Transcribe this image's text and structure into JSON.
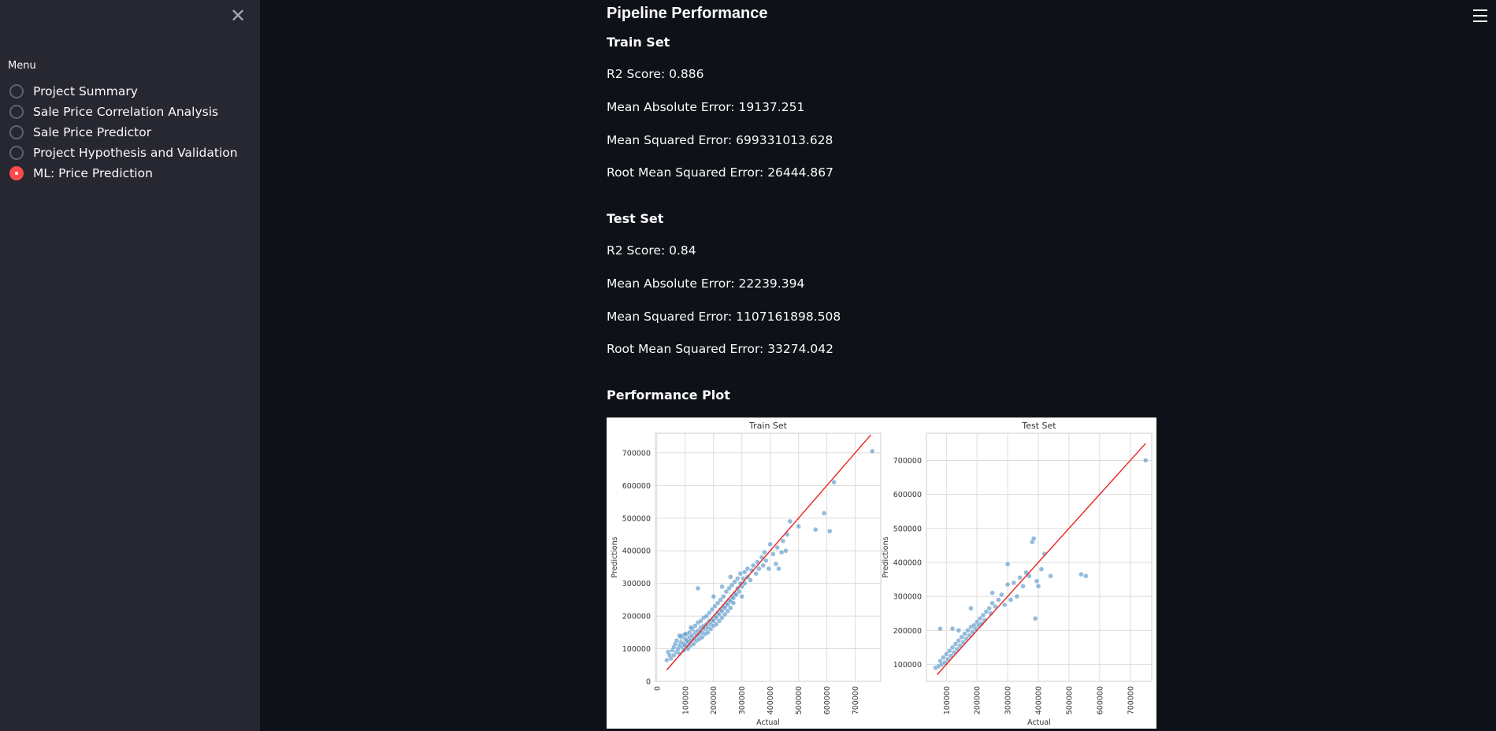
{
  "sidebar": {
    "close_glyph": "✕",
    "menu_label": "Menu",
    "items": [
      {
        "label": "Project Summary",
        "selected": false
      },
      {
        "label": "Sale Price Correlation Analysis",
        "selected": false
      },
      {
        "label": "Sale Price Predictor",
        "selected": false
      },
      {
        "label": "Project Hypothesis and Validation",
        "selected": false
      },
      {
        "label": "ML: Price Prediction",
        "selected": true
      }
    ]
  },
  "main": {
    "title": "Pipeline Performance",
    "train": {
      "heading": "Train Set",
      "r2": "R2 Score: 0.886",
      "mae": "Mean Absolute Error: 19137.251",
      "mse": "Mean Squared Error: 699331013.628",
      "rmse": "Root Mean Squared Error: 26444.867"
    },
    "test": {
      "heading": "Test Set",
      "r2": "R2 Score: 0.84",
      "mae": "Mean Absolute Error: 22239.394",
      "mse": "Mean Squared Error: 1107161898.508",
      "rmse": "Root Mean Squared Error: 33274.042"
    },
    "plot_heading": "Performance Plot"
  },
  "colors": {
    "accent": "#ff4b4b",
    "point": "#4c8fc4",
    "line": "#e8231f"
  },
  "chart_data": [
    {
      "type": "scatter",
      "title": "Train Set",
      "xlabel": "Actual",
      "ylabel": "Predictions",
      "xlim": [
        -5000,
        790000
      ],
      "ylim": [
        0,
        760000
      ],
      "xticks": [
        0,
        100000,
        200000,
        300000,
        400000,
        500000,
        600000,
        700000
      ],
      "yticks": [
        0,
        100000,
        200000,
        300000,
        400000,
        500000,
        600000,
        700000
      ],
      "grid": true,
      "reference_line": {
        "from": [
          35000,
          35000
        ],
        "to": [
          755000,
          755000
        ]
      },
      "points": [
        [
          35000,
          65000
        ],
        [
          40000,
          90000
        ],
        [
          45000,
          80000
        ],
        [
          50000,
          70000
        ],
        [
          55000,
          95000
        ],
        [
          60000,
          105000
        ],
        [
          60000,
          80000
        ],
        [
          65000,
          115000
        ],
        [
          70000,
          90000
        ],
        [
          70000,
          125000
        ],
        [
          75000,
          100000
        ],
        [
          80000,
          110000
        ],
        [
          80000,
          85000
        ],
        [
          85000,
          120000
        ],
        [
          85000,
          135000
        ],
        [
          90000,
          105000
        ],
        [
          90000,
          140000
        ],
        [
          95000,
          115000
        ],
        [
          95000,
          95000
        ],
        [
          100000,
          130000
        ],
        [
          100000,
          110000
        ],
        [
          105000,
          125000
        ],
        [
          105000,
          145000
        ],
        [
          110000,
          120000
        ],
        [
          110000,
          100000
        ],
        [
          115000,
          135000
        ],
        [
          115000,
          150000
        ],
        [
          120000,
          125000
        ],
        [
          120000,
          110000
        ],
        [
          125000,
          140000
        ],
        [
          125000,
          160000
        ],
        [
          130000,
          130000
        ],
        [
          130000,
          115000
        ],
        [
          135000,
          150000
        ],
        [
          135000,
          170000
        ],
        [
          140000,
          140000
        ],
        [
          140000,
          125000
        ],
        [
          145000,
          155000
        ],
        [
          145000,
          180000
        ],
        [
          150000,
          145000
        ],
        [
          150000,
          130000
        ],
        [
          155000,
          165000
        ],
        [
          155000,
          185000
        ],
        [
          160000,
          150000
        ],
        [
          160000,
          135000
        ],
        [
          165000,
          170000
        ],
        [
          165000,
          195000
        ],
        [
          170000,
          160000
        ],
        [
          170000,
          145000
        ],
        [
          175000,
          175000
        ],
        [
          175000,
          200000
        ],
        [
          180000,
          165000
        ],
        [
          180000,
          150000
        ],
        [
          185000,
          185000
        ],
        [
          185000,
          210000
        ],
        [
          190000,
          175000
        ],
        [
          190000,
          160000
        ],
        [
          195000,
          190000
        ],
        [
          195000,
          220000
        ],
        [
          200000,
          185000
        ],
        [
          200000,
          170000
        ],
        [
          205000,
          200000
        ],
        [
          205000,
          230000
        ],
        [
          210000,
          195000
        ],
        [
          210000,
          175000
        ],
        [
          215000,
          210000
        ],
        [
          215000,
          240000
        ],
        [
          220000,
          205000
        ],
        [
          220000,
          185000
        ],
        [
          225000,
          220000
        ],
        [
          225000,
          250000
        ],
        [
          230000,
          215000
        ],
        [
          230000,
          195000
        ],
        [
          235000,
          230000
        ],
        [
          235000,
          260000
        ],
        [
          240000,
          225000
        ],
        [
          240000,
          205000
        ],
        [
          245000,
          240000
        ],
        [
          245000,
          275000
        ],
        [
          250000,
          235000
        ],
        [
          250000,
          215000
        ],
        [
          255000,
          250000
        ],
        [
          255000,
          285000
        ],
        [
          260000,
          245000
        ],
        [
          260000,
          225000
        ],
        [
          265000,
          260000
        ],
        [
          265000,
          295000
        ],
        [
          270000,
          255000
        ],
        [
          270000,
          240000
        ],
        [
          275000,
          270000
        ],
        [
          275000,
          305000
        ],
        [
          280000,
          265000
        ],
        [
          285000,
          285000
        ],
        [
          285000,
          315000
        ],
        [
          290000,
          275000
        ],
        [
          295000,
          300000
        ],
        [
          295000,
          330000
        ],
        [
          300000,
          290000
        ],
        [
          305000,
          315000
        ],
        [
          310000,
          300000
        ],
        [
          310000,
          335000
        ],
        [
          320000,
          320000
        ],
        [
          320000,
          345000
        ],
        [
          330000,
          310000
        ],
        [
          335000,
          340000
        ],
        [
          340000,
          355000
        ],
        [
          350000,
          330000
        ],
        [
          355000,
          365000
        ],
        [
          360000,
          345000
        ],
        [
          370000,
          380000
        ],
        [
          375000,
          355000
        ],
        [
          380000,
          395000
        ],
        [
          385000,
          370000
        ],
        [
          395000,
          345000
        ],
        [
          400000,
          420000
        ],
        [
          410000,
          390000
        ],
        [
          420000,
          360000
        ],
        [
          425000,
          410000
        ],
        [
          430000,
          345000
        ],
        [
          440000,
          395000
        ],
        [
          445000,
          430000
        ],
        [
          455000,
          400000
        ],
        [
          460000,
          450000
        ],
        [
          470000,
          490000
        ],
        [
          500000,
          475000
        ],
        [
          560000,
          465000
        ],
        [
          590000,
          515000
        ],
        [
          610000,
          460000
        ],
        [
          625000,
          610000
        ],
        [
          760000,
          705000
        ],
        [
          145000,
          285000
        ],
        [
          100000,
          145000
        ],
        [
          80000,
          140000
        ],
        [
          120000,
          165000
        ],
        [
          200000,
          260000
        ],
        [
          230000,
          290000
        ],
        [
          260000,
          320000
        ],
        [
          300000,
          260000
        ]
      ]
    },
    {
      "type": "scatter",
      "title": "Test Set",
      "xlabel": "Actual",
      "ylabel": "Predictions",
      "xlim": [
        35000,
        770000
      ],
      "ylim": [
        50000,
        780000
      ],
      "xticks": [
        100000,
        200000,
        300000,
        400000,
        500000,
        600000,
        700000
      ],
      "yticks": [
        100000,
        200000,
        300000,
        400000,
        500000,
        600000,
        700000
      ],
      "grid": true,
      "reference_line": {
        "from": [
          70000,
          70000
        ],
        "to": [
          750000,
          750000
        ]
      },
      "points": [
        [
          65000,
          90000
        ],
        [
          75000,
          95000
        ],
        [
          80000,
          110000
        ],
        [
          85000,
          100000
        ],
        [
          90000,
          120000
        ],
        [
          95000,
          105000
        ],
        [
          100000,
          130000
        ],
        [
          105000,
          115000
        ],
        [
          110000,
          140000
        ],
        [
          115000,
          125000
        ],
        [
          120000,
          150000
        ],
        [
          125000,
          135000
        ],
        [
          130000,
          160000
        ],
        [
          135000,
          145000
        ],
        [
          140000,
          170000
        ],
        [
          145000,
          155000
        ],
        [
          150000,
          180000
        ],
        [
          155000,
          165000
        ],
        [
          160000,
          190000
        ],
        [
          165000,
          175000
        ],
        [
          170000,
          200000
        ],
        [
          175000,
          185000
        ],
        [
          180000,
          210000
        ],
        [
          185000,
          195000
        ],
        [
          190000,
          215000
        ],
        [
          195000,
          205000
        ],
        [
          200000,
          225000
        ],
        [
          205000,
          215000
        ],
        [
          210000,
          235000
        ],
        [
          215000,
          220000
        ],
        [
          220000,
          245000
        ],
        [
          225000,
          230000
        ],
        [
          230000,
          255000
        ],
        [
          240000,
          265000
        ],
        [
          245000,
          250000
        ],
        [
          250000,
          280000
        ],
        [
          260000,
          270000
        ],
        [
          270000,
          290000
        ],
        [
          280000,
          305000
        ],
        [
          290000,
          275000
        ],
        [
          300000,
          335000
        ],
        [
          310000,
          290000
        ],
        [
          320000,
          340000
        ],
        [
          330000,
          300000
        ],
        [
          340000,
          355000
        ],
        [
          350000,
          330000
        ],
        [
          360000,
          370000
        ],
        [
          370000,
          360000
        ],
        [
          380000,
          460000
        ],
        [
          385000,
          470000
        ],
        [
          390000,
          235000
        ],
        [
          395000,
          345000
        ],
        [
          400000,
          330000
        ],
        [
          410000,
          380000
        ],
        [
          420000,
          425000
        ],
        [
          440000,
          360000
        ],
        [
          540000,
          365000
        ],
        [
          555000,
          360000
        ],
        [
          750000,
          700000
        ],
        [
          80000,
          205000
        ],
        [
          120000,
          205000
        ],
        [
          180000,
          265000
        ],
        [
          300000,
          395000
        ],
        [
          250000,
          310000
        ],
        [
          140000,
          200000
        ]
      ]
    }
  ]
}
